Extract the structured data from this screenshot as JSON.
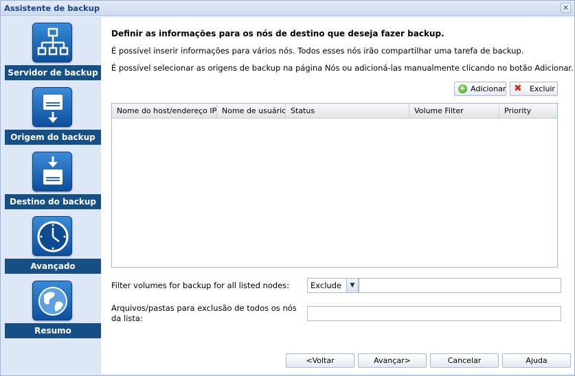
{
  "window": {
    "title": "Assistente de backup",
    "close_glyph": "✕"
  },
  "sidebar": {
    "steps": [
      {
        "label": "Servidor de backup",
        "icon": "network-nodes-icon"
      },
      {
        "label": "Origem do backup",
        "icon": "disk-export-icon"
      },
      {
        "label": "Destino do backup",
        "icon": "disk-import-icon"
      },
      {
        "label": "Avançado",
        "icon": "clock-icon"
      },
      {
        "label": "Resumo",
        "icon": "globe-icon"
      }
    ]
  },
  "main": {
    "heading": "Definir as informações para os nós de destino que deseja fazer backup.",
    "desc1": "É possível inserir informações para vários nós. Todos esses nós irão compartilhar uma tarefa de backup.",
    "desc2": "É possível selecionar as origens de backup na página Nós ou adicioná-las manualmente clicando no botão Adicionar.",
    "add_button": "Adicionar",
    "delete_button": "Excluir",
    "table": {
      "columns": [
        "Nome do host/endereço IP",
        "Nome de usuário",
        "Status",
        "Volume Filter",
        "Priority"
      ],
      "rows": []
    },
    "filter": {
      "label": "Filter volumes for backup for all listed nodes:",
      "mode": "Exclude",
      "value": ""
    },
    "exclusion": {
      "label": "Arquivos/pastas para exclusão de todos os nós da lista:",
      "value": ""
    }
  },
  "footer": {
    "back": "<Voltar",
    "next": "Avançar>",
    "cancel": "Cancelar",
    "help": "Ajuda"
  }
}
